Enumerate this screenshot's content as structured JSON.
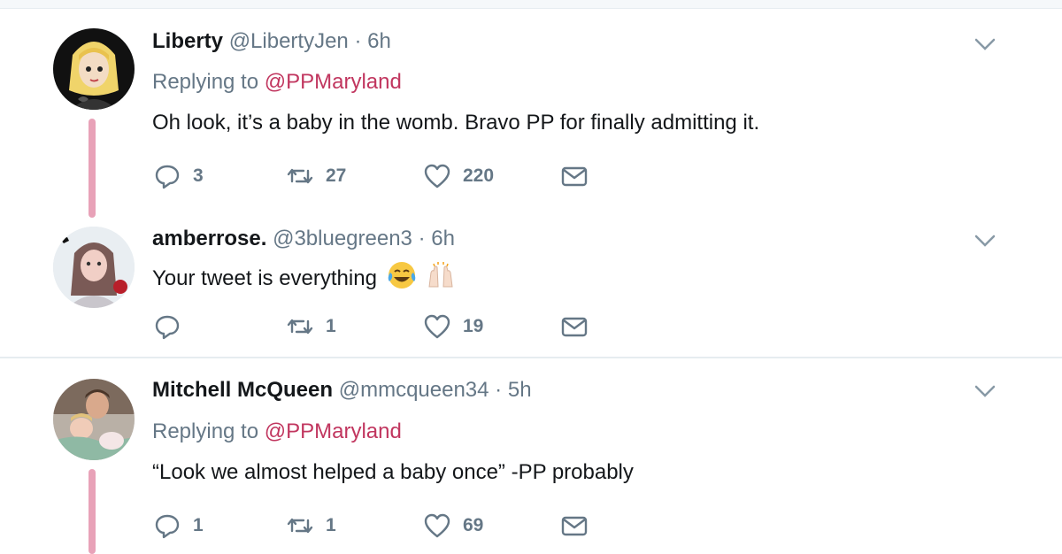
{
  "colors": {
    "accent_mention": "#c1365f",
    "thread_line": "#e8a2b8",
    "muted": "#657786",
    "text": "#14171a"
  },
  "tweets": [
    {
      "name": "Liberty",
      "handle": "@LibertyJen",
      "dot": "·",
      "time": "6h",
      "replying_prefix": "Replying to ",
      "replying_to": "@PPMaryland",
      "text": "Oh look, it’s a baby in the womb. Bravo PP for finally admitting it.",
      "reply_count": "3",
      "retweet_count": "27",
      "like_count": "220",
      "avatar_icon": "cartoon-girl-avatar"
    },
    {
      "name": "amberrose.",
      "handle": "@3bluegreen3",
      "dot": "·",
      "time": "6h",
      "text": "Your tweet is everything",
      "emojis": [
        "face-with-tears-of-joy-emoji",
        "raising-hands-emoji"
      ],
      "reply_count": "",
      "retweet_count": "1",
      "like_count": "19",
      "avatar_icon": "photo-avatar"
    },
    {
      "name": "Mitchell McQueen",
      "handle": "@mmcqueen34",
      "dot": "·",
      "time": "5h",
      "replying_prefix": "Replying to ",
      "replying_to": "@PPMaryland",
      "text": "“Look we almost helped a baby once” -PP probably",
      "reply_count": "1",
      "retweet_count": "1",
      "like_count": "69",
      "avatar_icon": "photo-avatar"
    }
  ]
}
